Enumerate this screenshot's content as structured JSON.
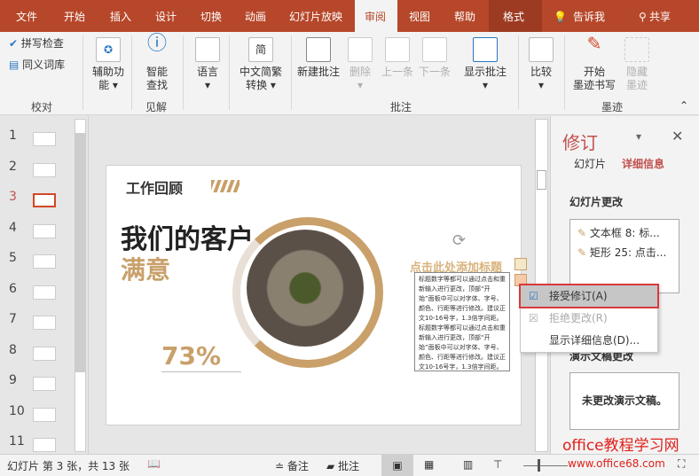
{
  "tabs": [
    "文件",
    "开始",
    "插入",
    "设计",
    "切换",
    "动画",
    "幻灯片放映",
    "审阅",
    "视图",
    "帮助",
    "格式"
  ],
  "tell_me": "告诉我",
  "share": "共享",
  "ribbon": {
    "spell": "拼写检查",
    "thesaurus": "同义词库",
    "accessibility": [
      "辅助功",
      "能"
    ],
    "smart_lookup": [
      "智能",
      "查找"
    ],
    "language": "语言",
    "convert": [
      "中文简繁",
      "转换"
    ],
    "new_comment": "新建批注",
    "delete": "删除",
    "prev": "上一条",
    "next": "下一条",
    "show_comments": "显示批注",
    "compare": "比较",
    "start_ink": [
      "开始",
      "墨迹书写"
    ],
    "hide_ink": [
      "隐藏",
      "墨迹"
    ],
    "groups": {
      "proofing": "校对",
      "insights": "见解",
      "comments": "批注",
      "ink": "墨迹"
    }
  },
  "thumbs": [
    "1",
    "2",
    "3",
    "4",
    "5",
    "6",
    "7",
    "8",
    "9",
    "10",
    "11"
  ],
  "slide": {
    "header": "工作回顾",
    "title1": "我们的客户",
    "title2": "满意",
    "percent": "73%",
    "placeholder": "点击此处添加标题",
    "body": "标题数字等都可以通过点击和重新输入进行更改，顶部“开始”面板中可以对字体、字号、颜色、行距等进行修改。建议正文10-16号字，1.3倍字间距。标题数字等都可以通过点击和重新输入进行更改，顶部“开始”面板中可以对字体、字号、颜色、行距等进行修改。建议正文10-16号字，1.3倍字间距。"
  },
  "pane": {
    "title": "修订",
    "tab_slides": "幻灯片",
    "tab_details": "详细信息",
    "slide_changes": "幻灯片更改",
    "changes": [
      "文本框 8: 标...",
      "矩形 25: 点击..."
    ],
    "pres_changes": "演示文稿更改",
    "no_changes": "未更改演示文稿。"
  },
  "menu": {
    "accept": "接受修订(A)",
    "reject": "拒绝更改(R)",
    "details": "显示详细信息(D)..."
  },
  "status": {
    "slide_info": "幻灯片 第 3 张，共 13 张",
    "notes": "备注",
    "comments": "批注"
  },
  "watermark": {
    "line1": "office教程学习网",
    "line2": "www.office68.com"
  }
}
